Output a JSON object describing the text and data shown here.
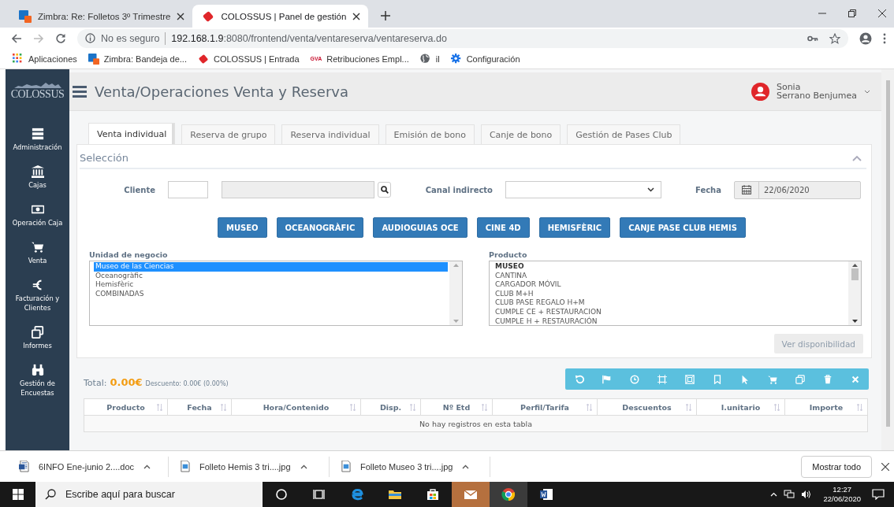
{
  "browser": {
    "tabs": [
      {
        "title": "Zimbra: Re: Folletos 3º Trimestre",
        "selected": false
      },
      {
        "title": "COLOSSUS | Panel de gestión",
        "selected": true
      }
    ],
    "address": {
      "security": "No es seguro",
      "host": "192.168.1.9",
      "path": ":8080/frontend/venta/ventareserva/ventareserva.do"
    },
    "bookmarks": [
      {
        "label": "Aplicaciones"
      },
      {
        "label": "Zimbra: Bandeja de..."
      },
      {
        "label": "COLOSSUS | Entrada"
      },
      {
        "badge": "GVA",
        "label": "Retribuciones Empl..."
      },
      {
        "label": "il"
      },
      {
        "label": "Configuración"
      }
    ]
  },
  "app": {
    "logo": "COLOSSUS",
    "sidebar": {
      "items": [
        {
          "label": "Administración"
        },
        {
          "label": "Cajas"
        },
        {
          "label": "Operación Caja"
        },
        {
          "label": "Venta"
        },
        {
          "label": "Facturación y Clientes"
        },
        {
          "label": "Informes"
        },
        {
          "label": "Gestión de Encuestas"
        }
      ]
    },
    "title": "Venta/Operaciones Venta y Reserva",
    "user": {
      "first_name": "Sonia",
      "last_name": "Serrano Benjumea"
    },
    "tabs": [
      {
        "label": "Venta individual",
        "selected": true
      },
      {
        "label": "Reserva de grupo",
        "selected": false
      },
      {
        "label": "Reserva individual",
        "selected": false
      },
      {
        "label": "Emisión de bono",
        "selected": false
      },
      {
        "label": "Canje de bono",
        "selected": false
      },
      {
        "label": "Gestión de Pases Club",
        "selected": false
      }
    ],
    "selection": {
      "title": "Selección",
      "cliente_label": "Cliente",
      "canal_label": "Canal indirecto",
      "fecha_label": "Fecha",
      "fecha_value": "22/06/2020",
      "category_buttons": [
        "MUSEO",
        "OCEANOGRÀFIC",
        "AUDIOGUIAS OCE",
        "CINE 4D",
        "HEMISFÈRIC",
        "CANJE PASE CLUB HEMIS"
      ],
      "unidad": {
        "label": "Unidad de negocio",
        "items": [
          {
            "text": "Museo de las Ciencias",
            "selected": true
          },
          {
            "text": "Oceanogràfic",
            "selected": false
          },
          {
            "text": "Hemisfèric",
            "selected": false
          },
          {
            "text": "COMBINADAS",
            "selected": false
          }
        ]
      },
      "producto": {
        "label": "Producto",
        "items": [
          {
            "text": "MUSEO",
            "kind": "group"
          },
          {
            "text": "CANTINA",
            "kind": "item"
          },
          {
            "text": "CARGADOR MÓVIL",
            "kind": "item"
          },
          {
            "text": "CLUB M+H",
            "kind": "item"
          },
          {
            "text": "CLUB PASE REGALO H+M",
            "kind": "item"
          },
          {
            "text": "CUMPLE CE + RESTAURACION",
            "kind": "item"
          },
          {
            "text": "CUMPLE H + RESTAURACIÓN",
            "kind": "item"
          }
        ]
      },
      "availability_button": {
        "label": "Ver disponibilidad",
        "disabled": true
      }
    },
    "summary": {
      "total_label": "Total:",
      "total_value": "0.00€",
      "discount": "Descuento: 0.00€ (0.00%)"
    },
    "table": {
      "columns": [
        "Producto",
        "Fecha",
        "Hora/Contenido",
        "Disp.",
        "Nº Etd",
        "Perfil/Tarifa",
        "Descuentos",
        "I.unitario",
        "Importe"
      ],
      "empty_message": "No hay registros en esta tabla"
    }
  },
  "downloads": {
    "items": [
      {
        "name": "6INFO Ene-junio 2....doc",
        "kind": "doc"
      },
      {
        "name": "Folleto Hemis 3 tri....jpg",
        "kind": "image"
      },
      {
        "name": "Folleto Museo 3 tri....jpg",
        "kind": "image"
      }
    ],
    "show_all": "Mostrar todo"
  },
  "taskbar": {
    "search_placeholder": "Escribe aquí para buscar",
    "time": "12:27",
    "date": "22/06/2020"
  }
}
